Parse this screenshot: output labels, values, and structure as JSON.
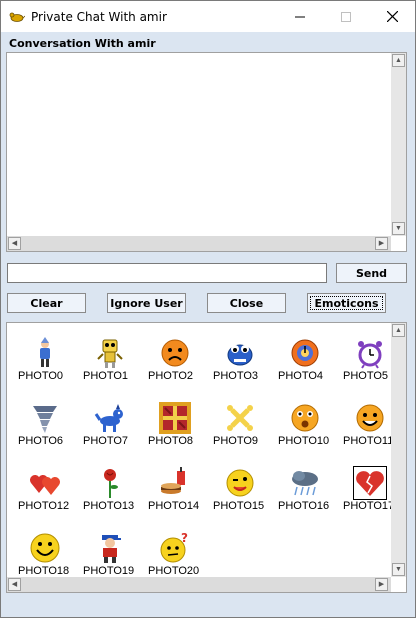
{
  "window": {
    "title": "Private Chat With amir",
    "min_glyph": "—",
    "max_glyph": "☐",
    "close_glyph": "✕"
  },
  "conversation": {
    "label": "Conversation With amir",
    "text": ""
  },
  "message": {
    "value": "",
    "placeholder": ""
  },
  "buttons": {
    "send": "Send",
    "clear": "Clear",
    "ignore": "Ignore User",
    "close": "Close",
    "emoticons": "Emoticons"
  },
  "emoticons": [
    {
      "label": "PHOTO0",
      "icon": "person-icon"
    },
    {
      "label": "PHOTO1",
      "icon": "robot-icon"
    },
    {
      "label": "PHOTO2",
      "icon": "sad-face-icon"
    },
    {
      "label": "PHOTO3",
      "icon": "blue-monster-icon"
    },
    {
      "label": "PHOTO4",
      "icon": "orange-clock-icon"
    },
    {
      "label": "PHOTO5",
      "icon": "alarm-clock-icon"
    },
    {
      "label": "PHOTO6",
      "icon": "tornado-icon"
    },
    {
      "label": "PHOTO7",
      "icon": "blue-dog-icon"
    },
    {
      "label": "PHOTO8",
      "icon": "gift-box-icon"
    },
    {
      "label": "PHOTO9",
      "icon": "bone-icon"
    },
    {
      "label": "PHOTO10",
      "icon": "surprised-face-icon"
    },
    {
      "label": "PHOTO11",
      "icon": "smiley-face-icon"
    },
    {
      "label": "PHOTO12",
      "icon": "hearts-icon"
    },
    {
      "label": "PHOTO13",
      "icon": "rose-icon"
    },
    {
      "label": "PHOTO14",
      "icon": "fast-food-icon"
    },
    {
      "label": "PHOTO15",
      "icon": "wink-face-icon"
    },
    {
      "label": "PHOTO16",
      "icon": "storm-cloud-icon"
    },
    {
      "label": "PHOTO17",
      "icon": "broken-heart-icon"
    },
    {
      "label": "PHOTO18",
      "icon": "grin-face-icon"
    },
    {
      "label": "PHOTO19",
      "icon": "boy-icon"
    },
    {
      "label": "PHOTO20",
      "icon": "confused-face-icon"
    }
  ],
  "selected_emoticon": "PHOTO17",
  "colors": {
    "window_bg": "#dbe5f1",
    "button_bg": "#eef3fa",
    "scrollbar": "#dcdcdc"
  }
}
